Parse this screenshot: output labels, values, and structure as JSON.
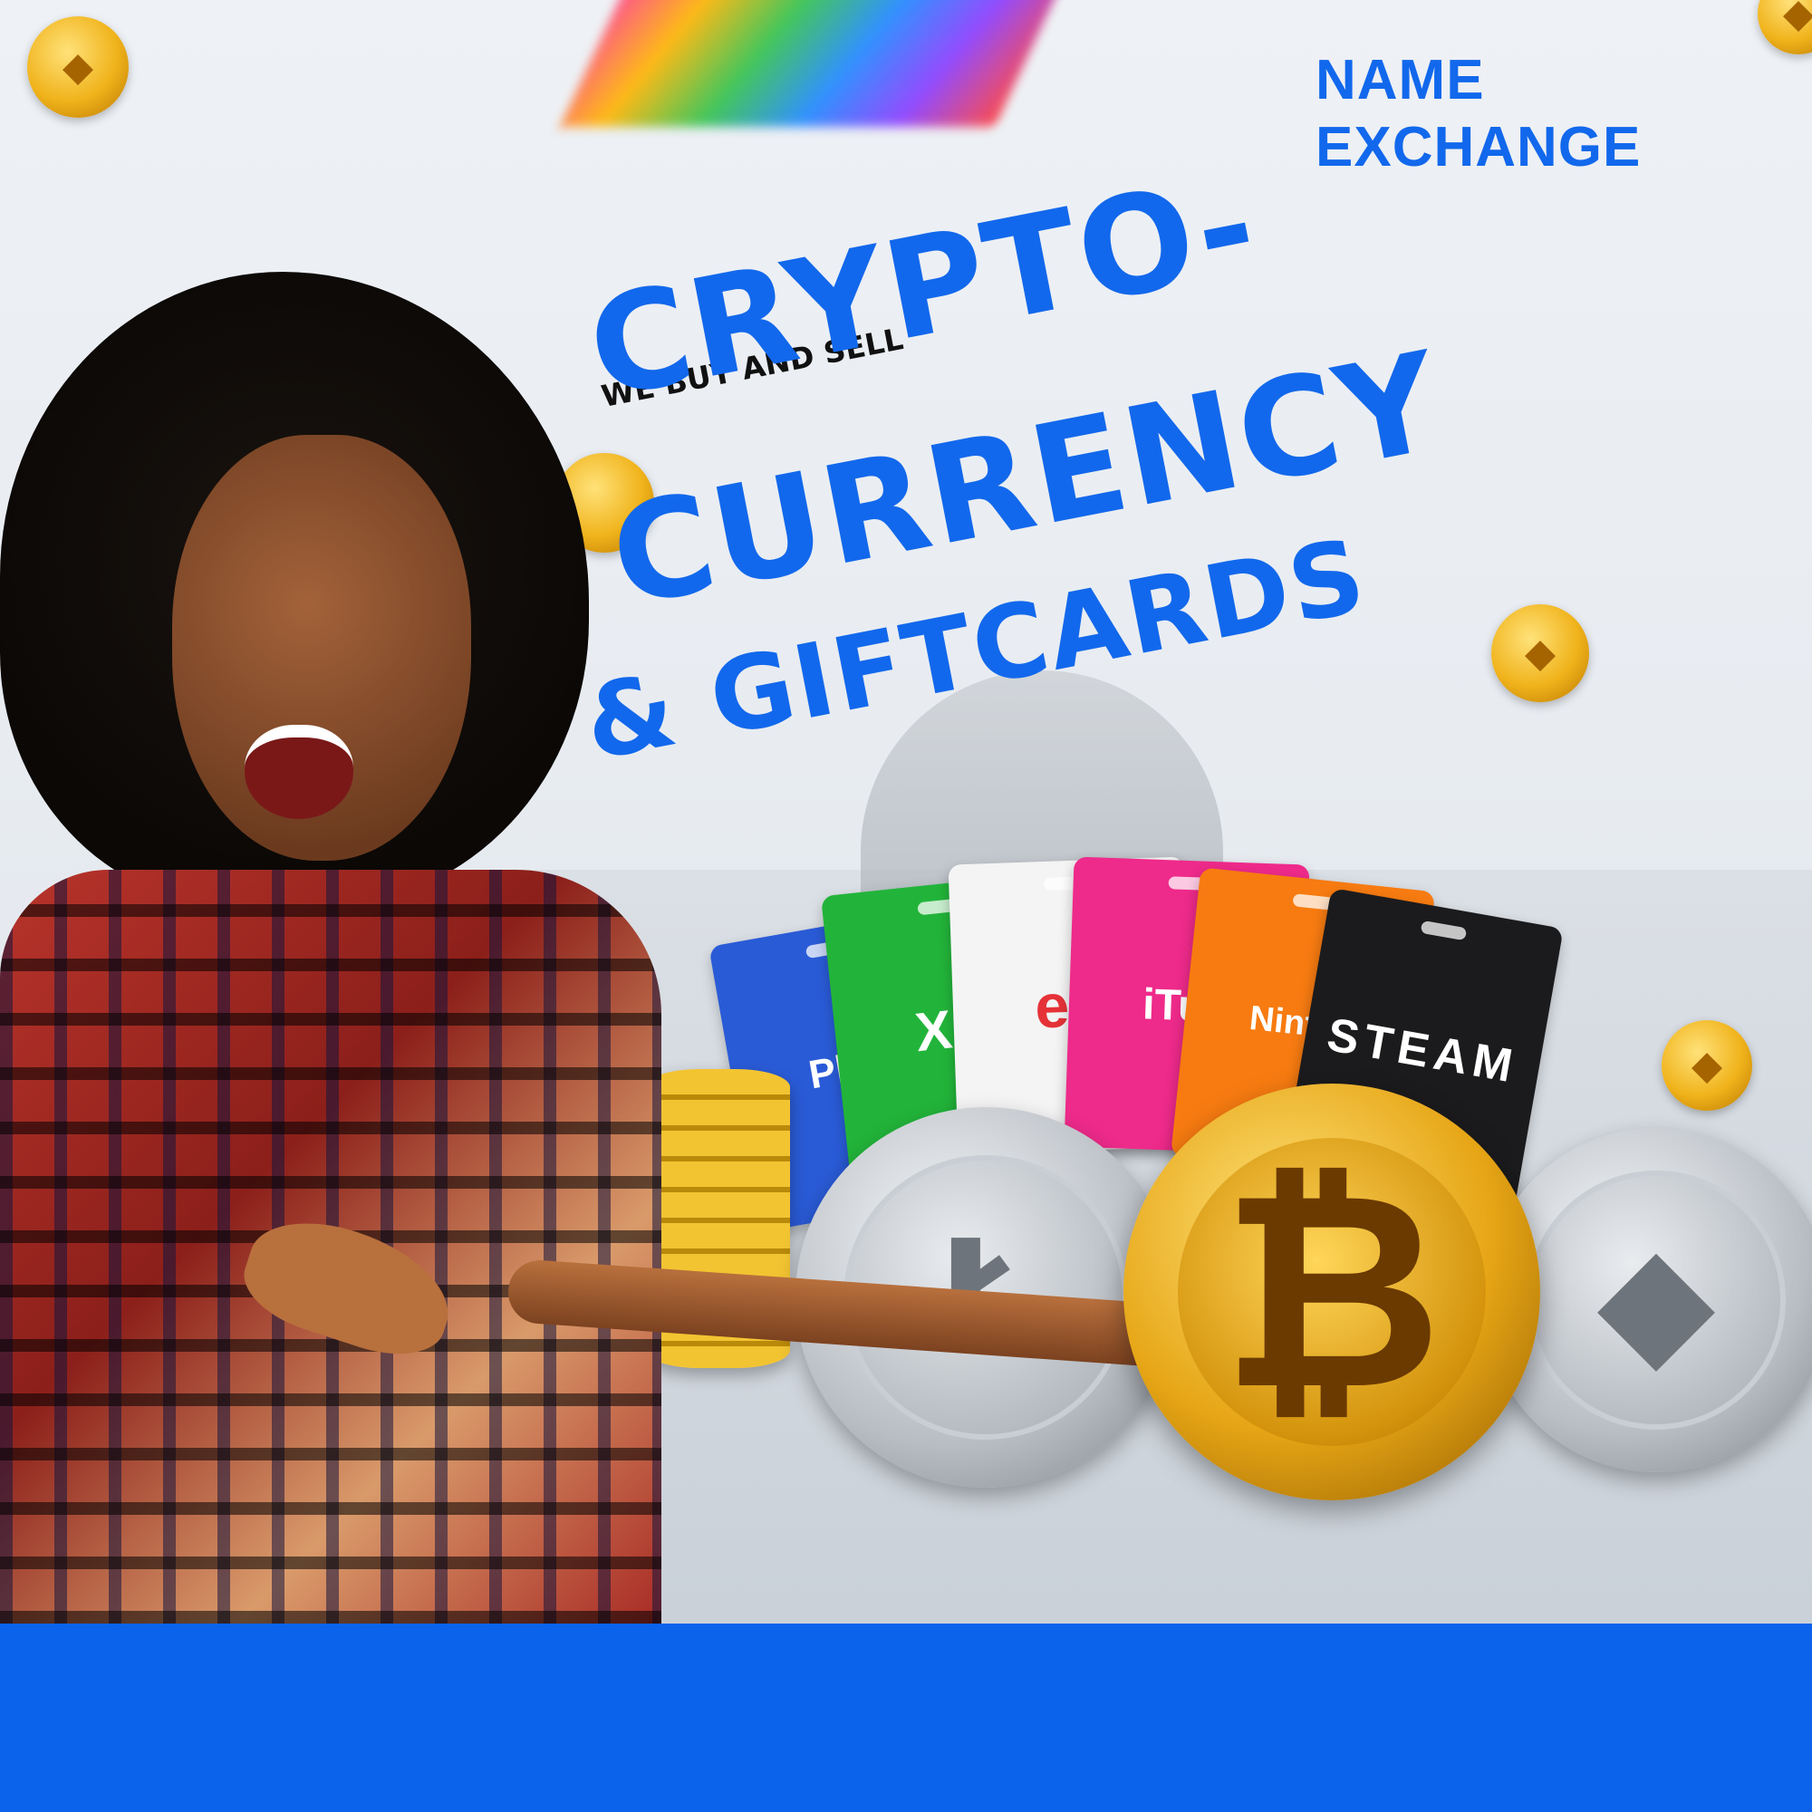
{
  "brand": {
    "line1": "NAME",
    "line2": "EXCHANGE"
  },
  "headline": {
    "kicker": "WE BUY AND SELL",
    "line1": "CRYPTO-",
    "line2": "CURRENCY",
    "line3": "& GIFTCARDS"
  },
  "gift_cards": [
    {
      "label": "Play",
      "color": "#2a5bd7",
      "text_color": "#ffffff"
    },
    {
      "label": "XB",
      "color": "#22b43a",
      "text_color": "#ffffff"
    },
    {
      "label": "eb",
      "color": "#f4f4f4",
      "text_color": "#e53238"
    },
    {
      "label": "iTun",
      "color": "#ee2a8a",
      "text_color": "#ffffff"
    },
    {
      "label": "Ninten",
      "color": "#f77b11",
      "text_color": "#ffffff"
    },
    {
      "label": "STEAM",
      "color": "#1b1b1d",
      "text_color": "#ffffff"
    }
  ],
  "coins": {
    "btc_symbol": "₿",
    "eth_symbol": "◆",
    "ltc_symbol": "Ł"
  },
  "colors": {
    "accent": "#1268ec",
    "band": "#0b63ec"
  }
}
